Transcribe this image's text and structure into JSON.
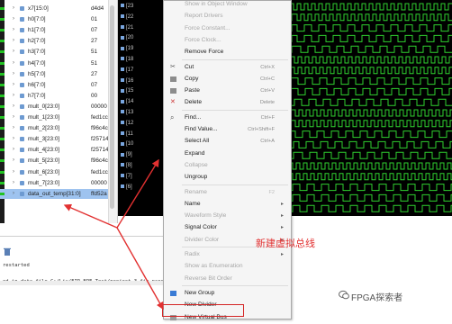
{
  "signals": [
    {
      "name": "x7[15:0]",
      "value": "d4d4",
      "expandable": true,
      "selected": false
    },
    {
      "name": "h0[7:0]",
      "value": "01",
      "expandable": true,
      "selected": false
    },
    {
      "name": "h1[7:0]",
      "value": "07",
      "expandable": true,
      "selected": false
    },
    {
      "name": "h2[7:0]",
      "value": "27",
      "expandable": true,
      "selected": false
    },
    {
      "name": "h3[7:0]",
      "value": "51",
      "expandable": true,
      "selected": false
    },
    {
      "name": "h4[7:0]",
      "value": "51",
      "expandable": true,
      "selected": false
    },
    {
      "name": "h5[7:0]",
      "value": "27",
      "expandable": true,
      "selected": false
    },
    {
      "name": "h6[7:0]",
      "value": "07",
      "expandable": true,
      "selected": false
    },
    {
      "name": "h7[7:0]",
      "value": "00",
      "expandable": true,
      "selected": false
    },
    {
      "name": "mult_0[23:0]",
      "value": "00000",
      "expandable": true,
      "selected": false
    },
    {
      "name": "mult_1[23:0]",
      "value": "fed1cc",
      "expandable": true,
      "selected": false
    },
    {
      "name": "mult_2[23:0]",
      "value": "f96c4c",
      "expandable": true,
      "selected": false
    },
    {
      "name": "mult_3[23:0]",
      "value": "f25714",
      "expandable": true,
      "selected": false
    },
    {
      "name": "mult_4[23:0]",
      "value": "f25714",
      "expandable": true,
      "selected": false
    },
    {
      "name": "mult_5[23:0]",
      "value": "f96c4c",
      "expandable": true,
      "selected": false
    },
    {
      "name": "mult_6[23:0]",
      "value": "fed1cc",
      "expandable": true,
      "selected": false
    },
    {
      "name": "mult_7[23:0]",
      "value": "00000",
      "expandable": true,
      "selected": false
    },
    {
      "name": "data_out_temp[31:0]",
      "value": "ffd52a",
      "expandable": true,
      "selected": true
    }
  ],
  "mid_column": [
    "[23",
    "[22",
    "[21",
    "[20",
    "[19",
    "[18",
    "[17",
    "[16",
    "[15",
    "[14",
    "[13",
    "[12",
    "[11",
    "[10",
    "[9]",
    "[8]",
    "[7]",
    "[6]"
  ],
  "context_menu": [
    {
      "label": "Show in Object Window",
      "enabled": false
    },
    {
      "label": "Report Drivers",
      "enabled": false
    },
    {
      "label": "Force Constant...",
      "enabled": false
    },
    {
      "label": "Force Clock...",
      "enabled": false
    },
    {
      "label": "Remove Force",
      "enabled": true,
      "sep_after": true
    },
    {
      "label": "Cut",
      "shortcut": "Ctrl+X",
      "enabled": true,
      "icon": "scissors-icon"
    },
    {
      "label": "Copy",
      "shortcut": "Ctrl+C",
      "enabled": true,
      "icon": "copy-icon"
    },
    {
      "label": "Paste",
      "shortcut": "Ctrl+V",
      "enabled": true,
      "icon": "paste-icon"
    },
    {
      "label": "Delete",
      "shortcut": "Delete",
      "enabled": true,
      "icon": "delete-icon",
      "sep_after": true
    },
    {
      "label": "Find...",
      "shortcut": "Ctrl+F",
      "enabled": true,
      "icon": "find-icon"
    },
    {
      "label": "Find Value...",
      "shortcut": "Ctrl+Shift+F",
      "enabled": true
    },
    {
      "label": "Select All",
      "shortcut": "Ctrl+A",
      "enabled": true
    },
    {
      "label": "Expand",
      "enabled": true
    },
    {
      "label": "Collapse",
      "enabled": false
    },
    {
      "label": "Ungroup",
      "enabled": true,
      "sep_after": true
    },
    {
      "label": "Rename",
      "shortcut": "F2",
      "enabled": false
    },
    {
      "label": "Name",
      "enabled": true,
      "submenu": true
    },
    {
      "label": "Waveform Style",
      "enabled": false,
      "submenu": true
    },
    {
      "label": "Signal Color",
      "enabled": true,
      "submenu": true
    },
    {
      "label": "Divider Color",
      "enabled": false,
      "submenu": true,
      "sep_after": true
    },
    {
      "label": "Radix",
      "enabled": false,
      "submenu": true
    },
    {
      "label": "Show as Enumeration",
      "enabled": false
    },
    {
      "label": "Reverse Bit Order",
      "enabled": false,
      "sep_after": true
    },
    {
      "label": "New Group",
      "enabled": true,
      "icon": "new-group-icon"
    },
    {
      "label": "New Divider",
      "enabled": true
    },
    {
      "label": "New Virtual Bus",
      "enabled": true,
      "icon": "virtual-bus-icon",
      "highlighted": true
    }
  ],
  "console": {
    "line1": "restarted",
    "line2": "ed in data file C:/Liu/FIR_BPF_Test/project_3_fir_parre"
  },
  "annotation": "新建虚拟总线",
  "watermark": "FPGA探索者",
  "colors": {
    "wave": "#2fd12f",
    "highlight": "#d42424",
    "annotation": "#e23131",
    "selection": "#9ec3ef"
  }
}
